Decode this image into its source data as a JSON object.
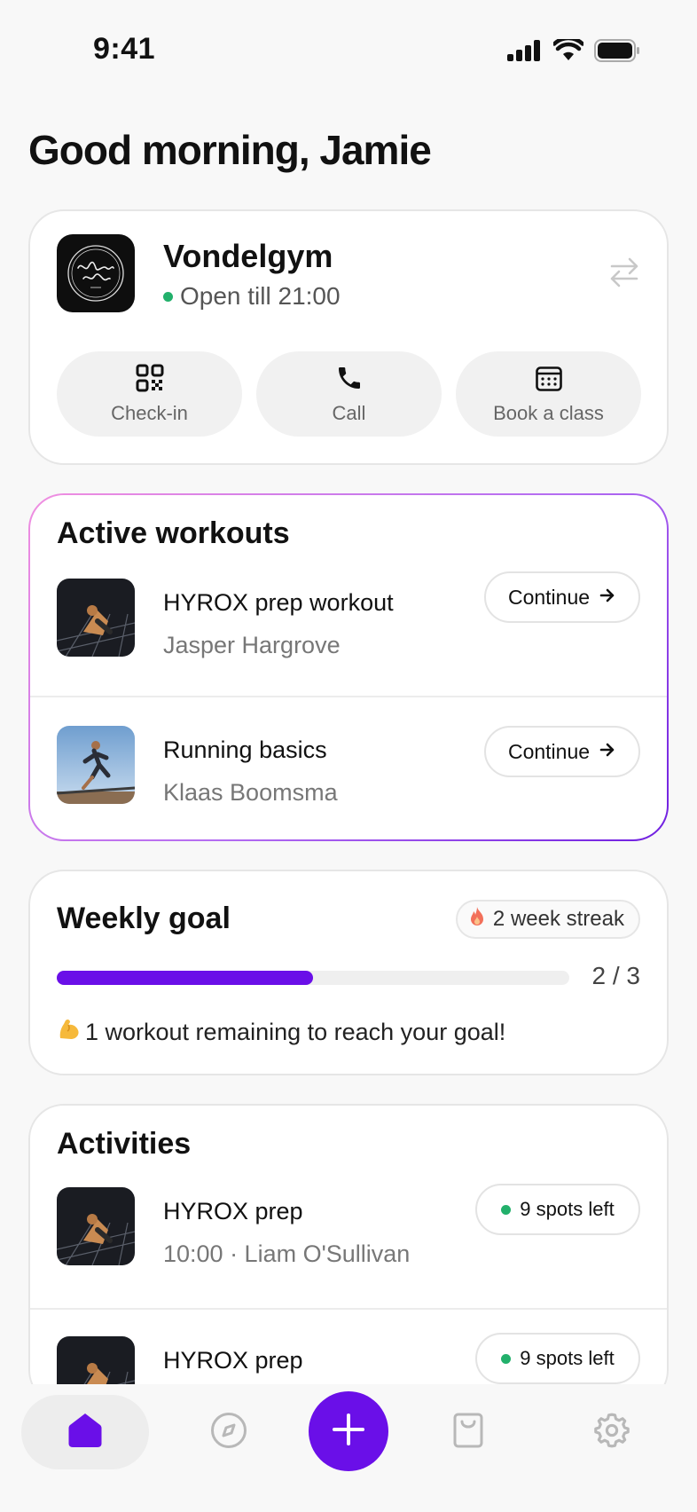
{
  "status_bar": {
    "time": "9:41",
    "icons": [
      "signal-icon",
      "wifi-icon",
      "battery-icon"
    ]
  },
  "greeting": "Good morning, Jamie",
  "gym": {
    "name": "Vondelgym",
    "status": "Open till 21:00",
    "status_color": "#22b06b",
    "actions": [
      {
        "label": "Check-in",
        "icon": "qr-code-icon"
      },
      {
        "label": "Call",
        "icon": "phone-icon"
      },
      {
        "label": "Book a class",
        "icon": "calendar-icon"
      }
    ]
  },
  "active_workouts": {
    "title": "Active workouts",
    "items": [
      {
        "title": "HYROX prep workout",
        "coach": "Jasper Hargrove",
        "button": "Continue"
      },
      {
        "title": "Running basics",
        "coach": "Klaas Boomsma",
        "button": "Continue"
      }
    ]
  },
  "weekly_goal": {
    "title": "Weekly goal",
    "streak": "2 week streak",
    "progress_done": 2,
    "progress_total": 3,
    "progress_label": "2 / 3",
    "note": "1 workout remaining to reach your goal!",
    "accent": "#6a0fe8"
  },
  "activities": {
    "title": "Activities",
    "items": [
      {
        "title": "HYROX prep",
        "meta": "10:00 · Liam O'Sullivan",
        "spots": "9 spots left"
      },
      {
        "title": "HYROX prep",
        "meta": "",
        "spots": "9 spots left"
      }
    ]
  },
  "tab_bar": {
    "tabs": [
      "home-icon",
      "explore-icon",
      "add-icon",
      "shop-icon",
      "settings-icon"
    ],
    "active": "home-icon"
  }
}
